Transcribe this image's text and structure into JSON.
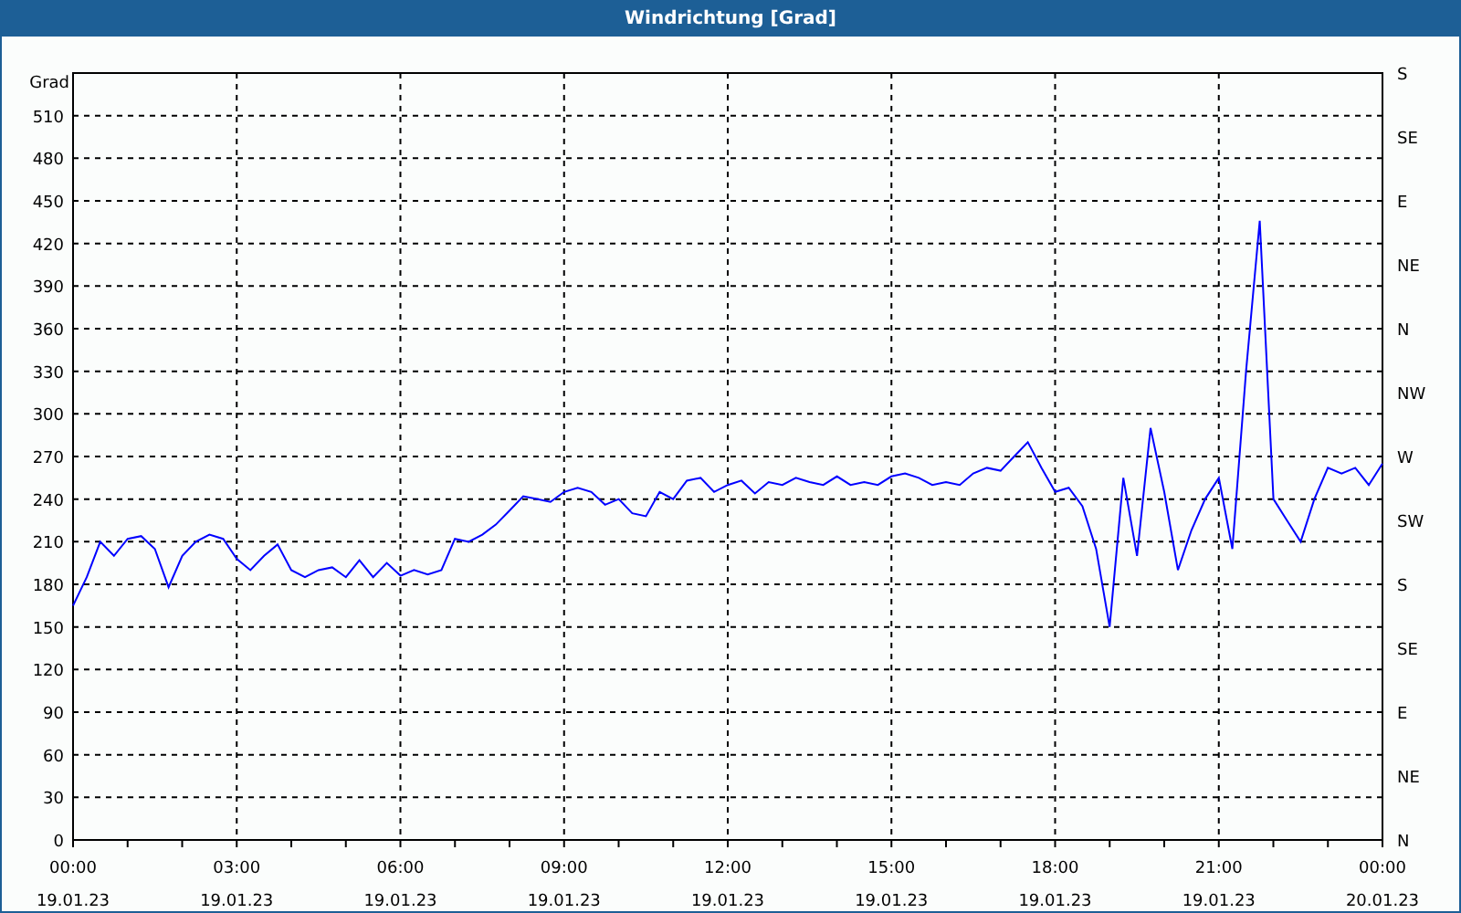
{
  "window": {
    "title": "Windrichtung [Grad]"
  },
  "chart": {
    "chart_data": {
      "type": "line",
      "grid": true,
      "ylabel": "Grad",
      "ylim": [
        0,
        540
      ],
      "yticks": [
        0,
        30,
        60,
        90,
        120,
        150,
        180,
        210,
        240,
        270,
        300,
        330,
        360,
        390,
        420,
        450,
        480,
        510
      ],
      "categories": [
        "00:00 19.01.23",
        null,
        null,
        null,
        null,
        null,
        null,
        null,
        null,
        null,
        null,
        null,
        "03:00 19.01.23",
        null,
        null,
        null,
        null,
        null,
        null,
        null,
        null,
        null,
        null,
        null,
        "06:00 19.01.23",
        null,
        null,
        null,
        null,
        null,
        null,
        null,
        null,
        null,
        null,
        null,
        "09:00 19.01.23",
        null,
        null,
        null,
        null,
        null,
        null,
        null,
        null,
        null,
        null,
        null,
        "12:00 19.01.23",
        null,
        null,
        null,
        null,
        null,
        null,
        null,
        null,
        null,
        null,
        null,
        "15:00 19.01.23",
        null,
        null,
        null,
        null,
        null,
        null,
        null,
        null,
        null,
        null,
        null,
        "18:00 19.01.23",
        null,
        null,
        null,
        null,
        null,
        null,
        null,
        null,
        null,
        null,
        null,
        "21:00 19.01.23",
        null,
        null,
        null,
        null,
        null,
        null,
        null,
        null,
        null,
        null,
        null,
        "00:00 20.01.23"
      ],
      "series": [
        {
          "color": "#0000ff",
          "values": [
            165,
            185,
            210,
            200,
            212,
            214,
            205,
            178,
            200,
            210,
            215,
            212,
            198,
            190,
            200,
            208,
            190,
            185,
            190,
            192,
            185,
            197,
            185,
            195,
            186,
            190,
            187,
            190,
            212,
            210,
            215,
            222,
            232,
            242,
            240,
            238,
            245,
            248,
            245,
            236,
            240,
            230,
            228,
            245,
            240,
            253,
            255,
            245,
            250,
            253,
            244,
            252,
            250,
            255,
            252,
            250,
            256,
            250,
            252,
            250,
            256,
            258,
            255,
            250,
            252,
            250,
            258,
            262,
            260,
            270,
            280,
            262,
            245,
            248,
            235,
            205,
            150,
            255,
            200,
            290,
            245,
            190,
            218,
            240,
            255,
            205,
            330,
            436,
            240,
            225,
            210,
            240,
            262,
            258,
            262,
            250,
            265
          ]
        }
      ]
    },
    "right_ticks": [
      "S",
      "SE",
      "E",
      "NE",
      "N",
      "NW",
      "W",
      "SW",
      "S",
      "SE",
      "E",
      "NE",
      "N"
    ]
  }
}
